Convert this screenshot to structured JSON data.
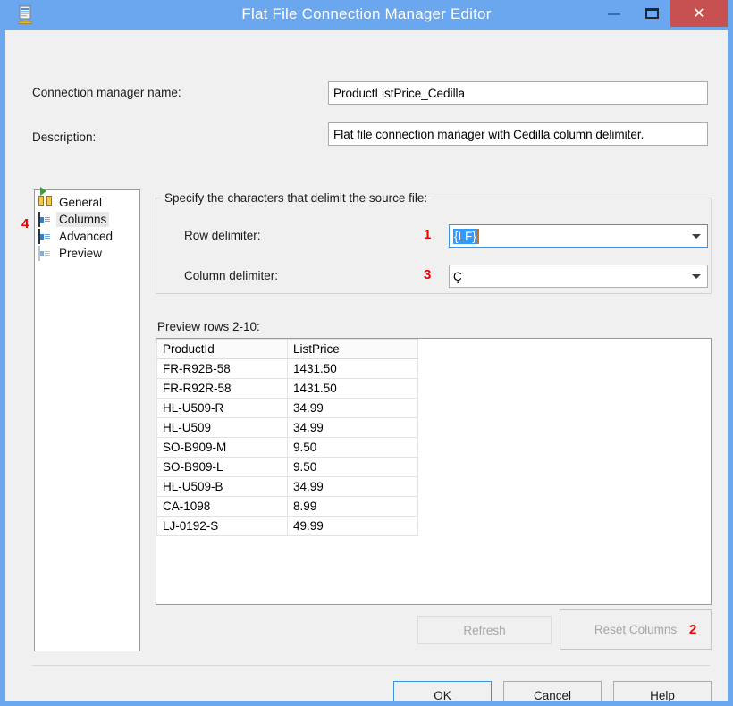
{
  "window": {
    "title": "Flat File Connection Manager Editor",
    "app_icon": "flat-file-connection-icon",
    "minimize_label": "",
    "maximize_label": "",
    "close_label": "✕"
  },
  "form": {
    "connection_manager_name_label": "Connection manager name:",
    "connection_manager_name_value": "ProductListPrice_Cedilla",
    "description_label": "Description:",
    "description_value": "Flat file connection manager with Cedilla column delimiter."
  },
  "tree": {
    "items": [
      {
        "label": "General",
        "icon": "general-connector-icon",
        "selected": false
      },
      {
        "label": "Columns",
        "icon": "columns-grid-icon",
        "selected": true
      },
      {
        "label": "Advanced",
        "icon": "advanced-grid-icon",
        "selected": false
      },
      {
        "label": "Preview",
        "icon": "preview-grid-icon",
        "selected": false
      }
    ]
  },
  "delimiters": {
    "group_title": "Specify the characters that delimit the source file:",
    "row_delimiter_label": "Row delimiter:",
    "row_delimiter_value": "{LF}",
    "column_delimiter_label": "Column delimiter:",
    "column_delimiter_value": "Ç"
  },
  "preview": {
    "label": "Preview rows 2-10:",
    "columns": [
      "ProductId",
      "ListPrice"
    ],
    "rows": [
      [
        "FR-R92B-58",
        "1431.50"
      ],
      [
        "FR-R92R-58",
        "1431.50"
      ],
      [
        "HL-U509-R",
        "34.99"
      ],
      [
        "HL-U509",
        "34.99"
      ],
      [
        "SO-B909-M",
        "9.50"
      ],
      [
        "SO-B909-L",
        "9.50"
      ],
      [
        "HL-U509-B",
        "34.99"
      ],
      [
        "CA-1098",
        "8.99"
      ],
      [
        "LJ-0192-S",
        "49.99"
      ]
    ]
  },
  "buttons": {
    "refresh": "Refresh",
    "reset_columns": "Reset Columns",
    "ok": "OK",
    "cancel": "Cancel",
    "help": "Help"
  },
  "annotations": [
    {
      "id": "1",
      "text": "1"
    },
    {
      "id": "2",
      "text": "2"
    },
    {
      "id": "3",
      "text": "3"
    },
    {
      "id": "4",
      "text": "4"
    }
  ],
  "colors": {
    "window_frame": "#6ba7ef",
    "dialog_background": "#f0f0f0",
    "close_button": "#c75050",
    "focus_border": "#3e93e0",
    "selection_highlight": "#3399ff",
    "annotation_red": "#ee0000"
  }
}
